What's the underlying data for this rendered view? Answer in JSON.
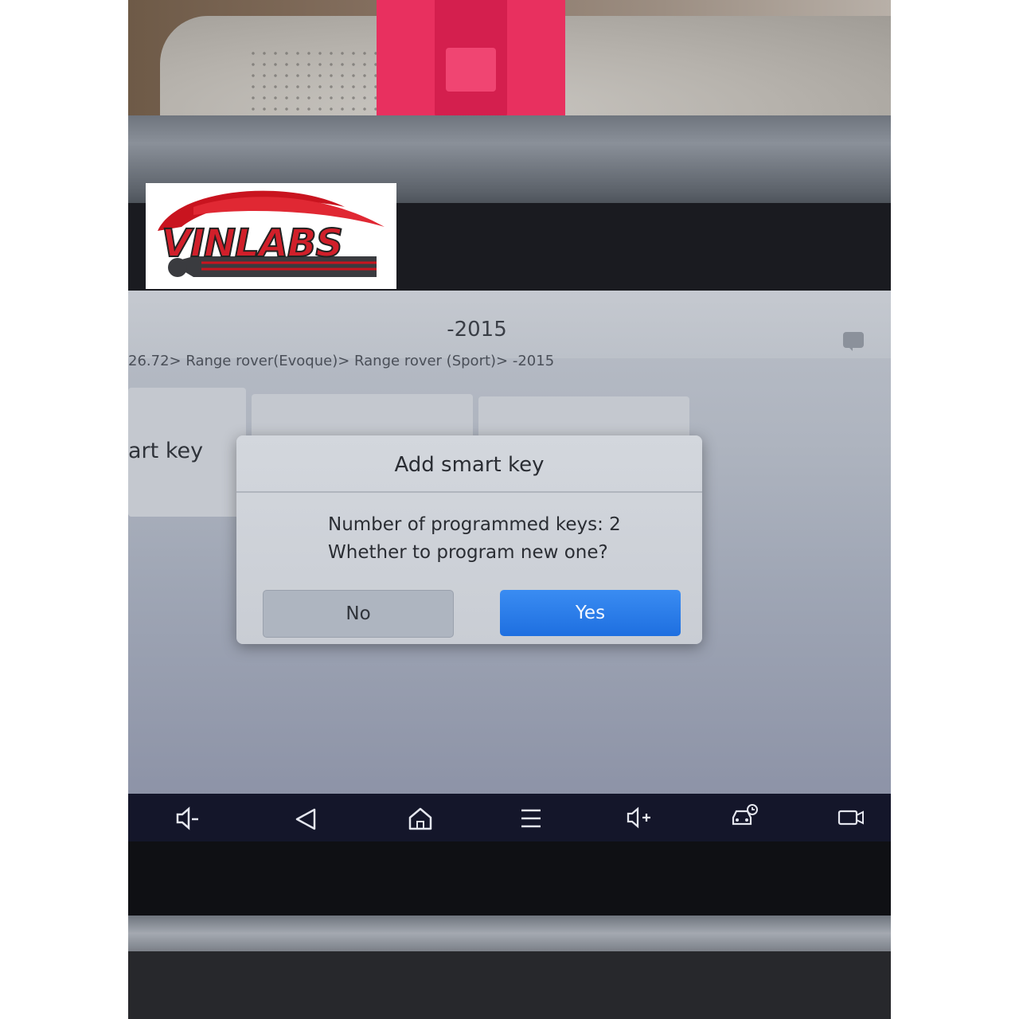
{
  "screen": {
    "title": "-2015",
    "breadcrumb": "26.72> Range rover(Evoque)> Range rover (Sport)> -2015",
    "tile_label": "art key"
  },
  "dialog": {
    "title": "Add smart key",
    "line1": "Number of programmed keys: 2",
    "line2": "Whether to program new one?",
    "no_label": "No",
    "yes_label": "Yes"
  },
  "navbar": {
    "items": [
      "volume-down-icon",
      "back-icon",
      "home-icon",
      "menu-icon",
      "volume-up-icon",
      "vehicle-diagnostic-icon",
      "screen-record-icon"
    ]
  },
  "logo": {
    "text": "VINLABS"
  },
  "colors": {
    "yes_button": "#1e6fe0",
    "no_button": "#aeb5c0",
    "logo_red": "#d11f2a",
    "navbar": "#14162a"
  }
}
